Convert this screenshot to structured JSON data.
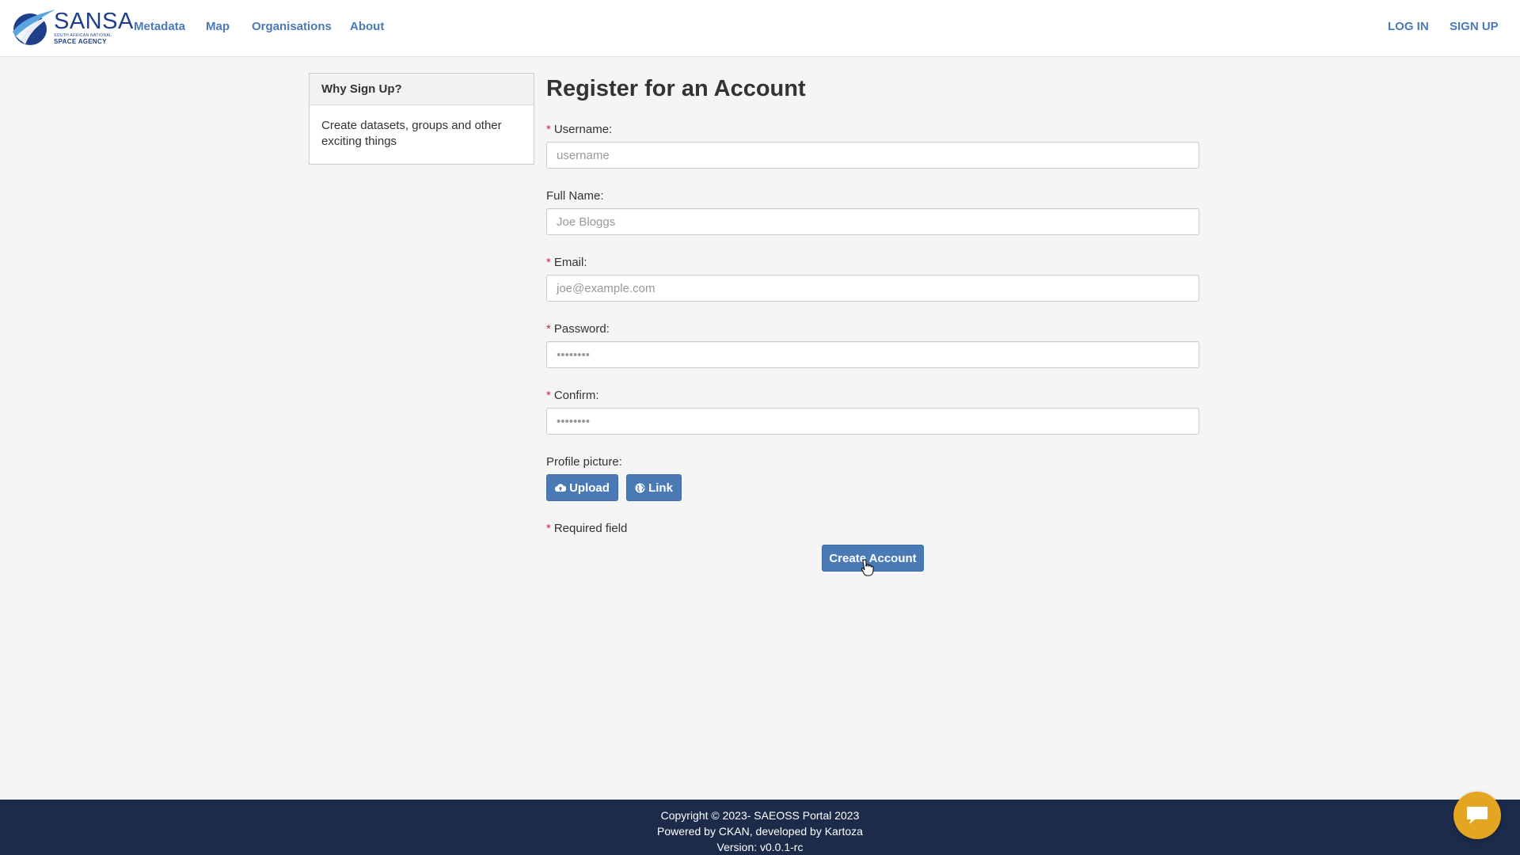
{
  "brand": {
    "name": "SANSA",
    "subtitle1": "SOUTH AFRICAN NATIONAL",
    "subtitle2": "SPACE AGENCY",
    "color": "#1f3e8c"
  },
  "nav": {
    "items": [
      {
        "label": "Metadata"
      },
      {
        "label": "Map"
      },
      {
        "label": "Organisations"
      },
      {
        "label": "About"
      }
    ],
    "login_label": "LOG IN",
    "signup_label": "SIGN UP"
  },
  "sidebar": {
    "heading": "Why Sign Up?",
    "body": "Create datasets, groups and other exciting things"
  },
  "form": {
    "title": "Register for an Account",
    "required_marker": "*",
    "fields": {
      "username": {
        "label": "Username:",
        "placeholder": "username",
        "value": "",
        "required": true
      },
      "fullname": {
        "label": "Full Name:",
        "placeholder": "Joe Bloggs",
        "value": "",
        "required": false
      },
      "email": {
        "label": "Email:",
        "placeholder": "joe@example.com",
        "value": "",
        "required": true
      },
      "password": {
        "label": "Password:",
        "placeholder": "••••••••",
        "value": "",
        "required": true
      },
      "confirm": {
        "label": "Confirm:",
        "placeholder": "••••••••",
        "value": "",
        "required": true
      }
    },
    "profile_picture_label": "Profile picture:",
    "upload_label": "Upload",
    "link_label": "Link",
    "required_note": "Required field",
    "submit_label": "Create Account"
  },
  "footer": {
    "copyright": "Copyright © 2023- SAEOSS Portal 2023",
    "powered": "Powered by CKAN, developed by Kartoza",
    "version": "Version: v0.0.1-rc"
  },
  "colors": {
    "accent": "#4a7ab6",
    "required": "#c6303e",
    "footer_bg": "#1c2b4a",
    "chat_bg": "#e3a522"
  },
  "icons": {
    "upload": "cloud-upload-icon",
    "link": "globe-icon",
    "chat": "chat-bubble-icon"
  }
}
